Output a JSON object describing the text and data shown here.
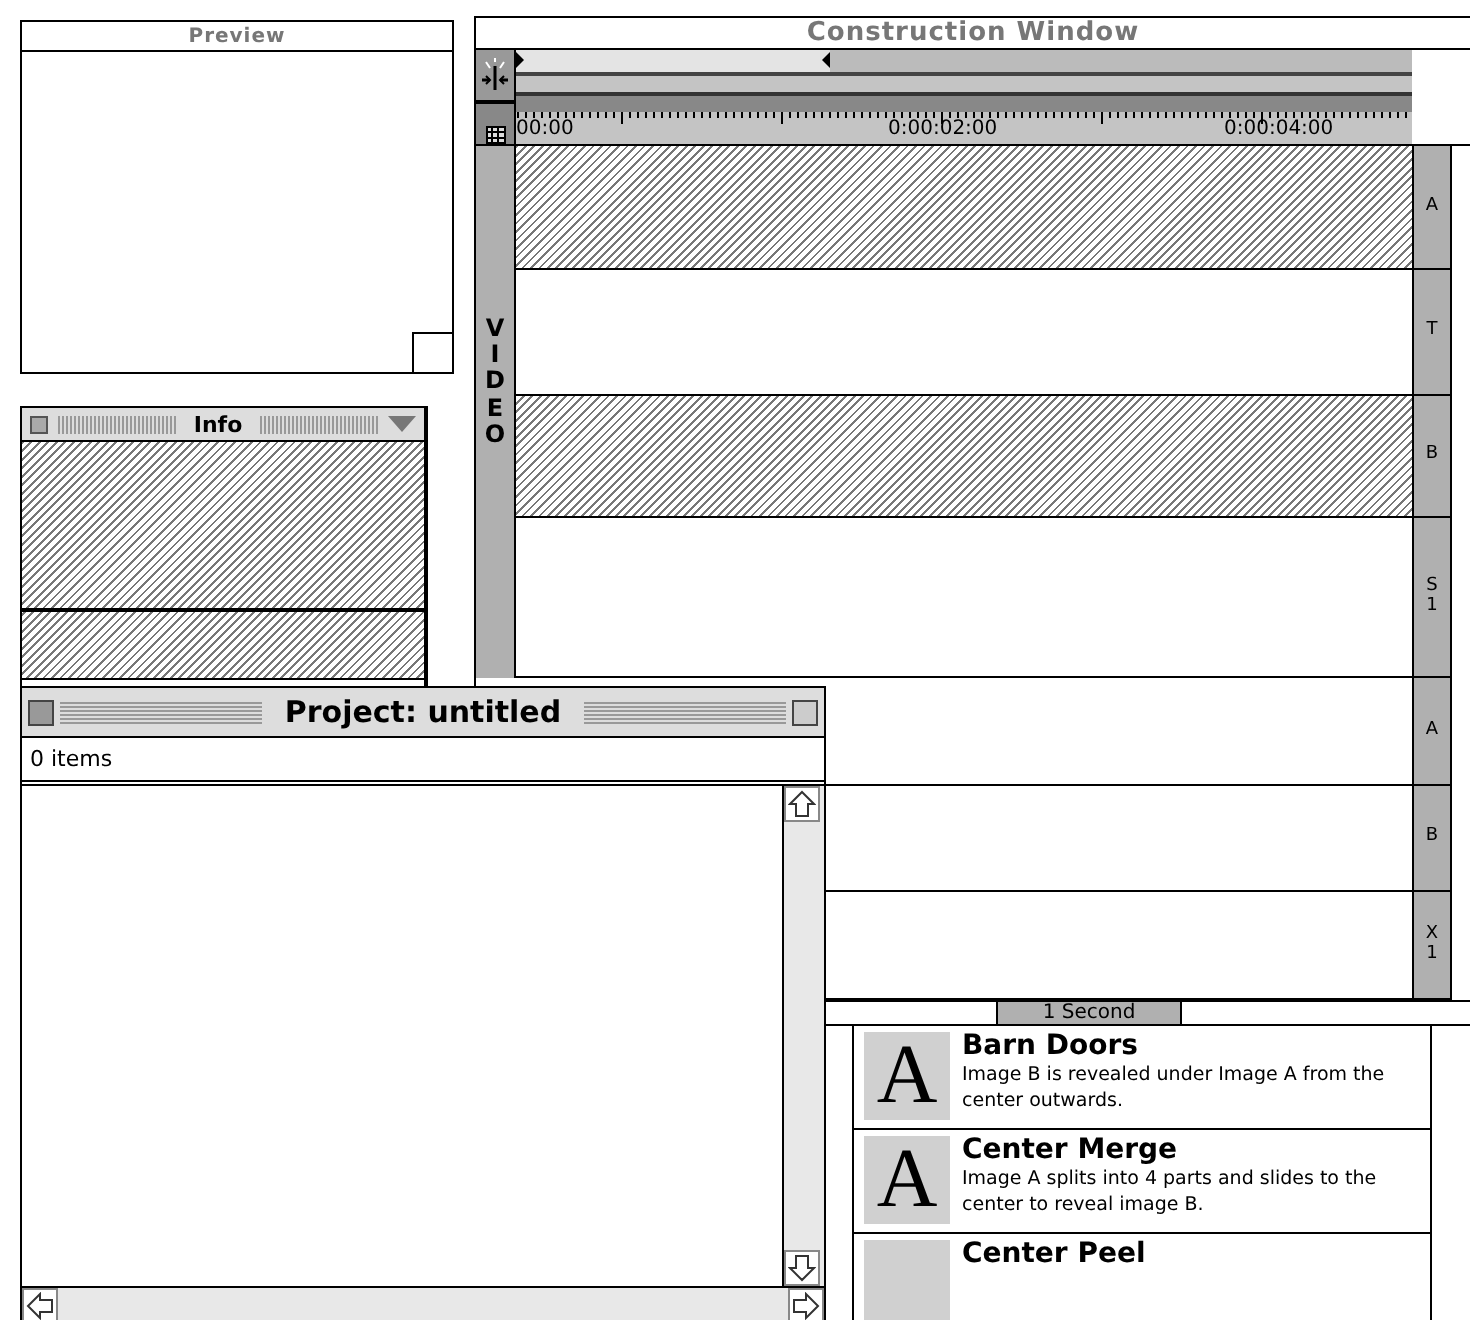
{
  "preview": {
    "title": "Preview"
  },
  "info": {
    "title": "Info"
  },
  "construction": {
    "title": "Construction Window",
    "ruler_labels": [
      "00:00",
      "0:00:02:00",
      "0:00:04:00"
    ],
    "video_label": "VIDEO",
    "video_tracks": [
      {
        "label": "A",
        "hatched": true
      },
      {
        "label": "T",
        "hatched": false
      },
      {
        "label": "B",
        "hatched": true
      },
      {
        "label": "S1",
        "hatched": false
      }
    ],
    "audio_tracks": [
      {
        "label": "A"
      },
      {
        "label": "B"
      },
      {
        "label": "X1"
      }
    ],
    "time_unit": "1 Second",
    "zoom_slider": {
      "level": 0.35
    }
  },
  "transitions": [
    {
      "icon_letter": "A",
      "name": "Barn Doors",
      "description": "Image B is revealed under Image A from the center outwards."
    },
    {
      "icon_letter": "A",
      "name": "Center Merge",
      "description": "Image A splits into 4 parts and slides to the center to reveal image B."
    },
    {
      "name": "Center Peel"
    }
  ],
  "project": {
    "title": "Project: untitled",
    "count": "0 items"
  }
}
